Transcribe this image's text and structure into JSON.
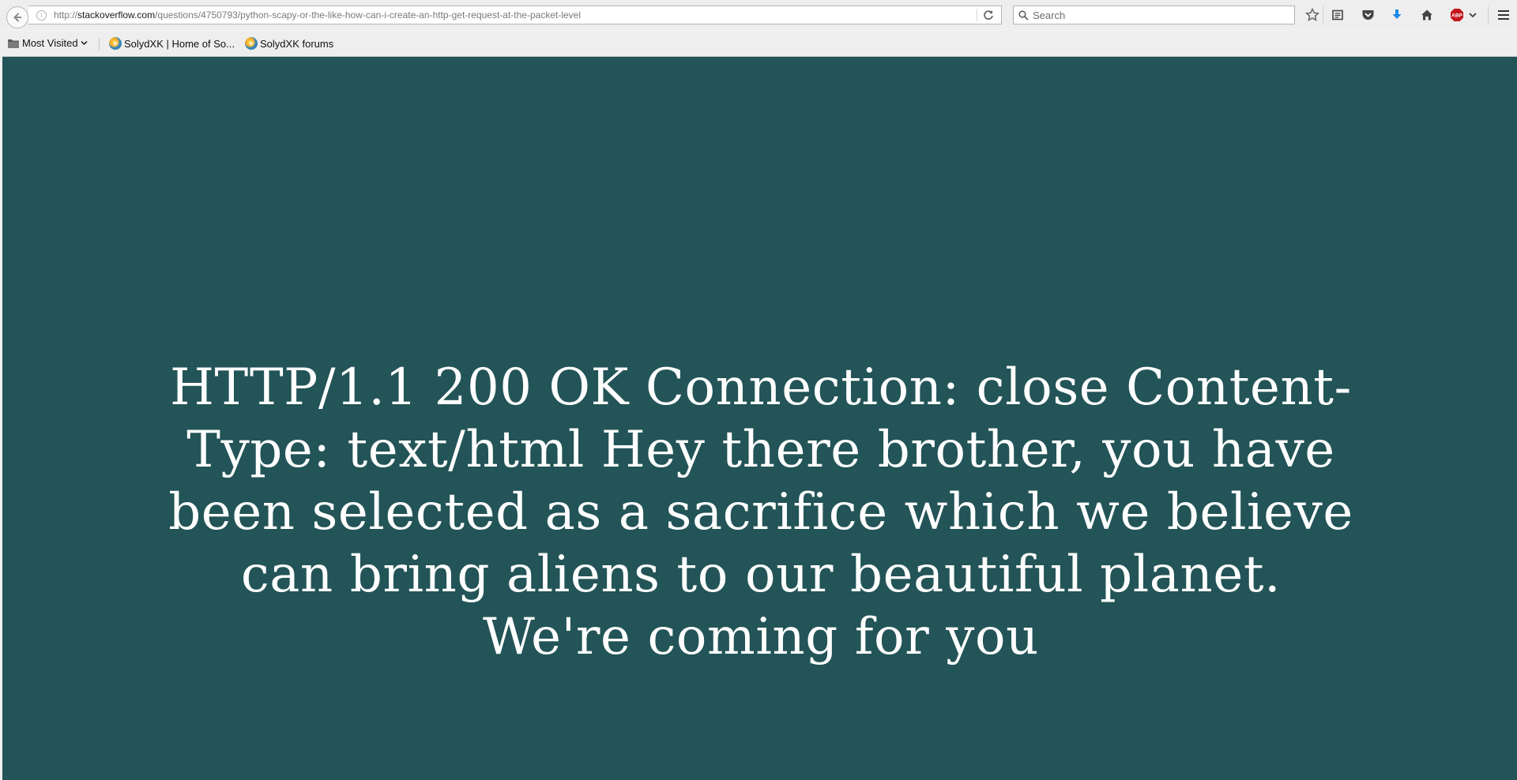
{
  "toolbar": {
    "url_prefix": "http://",
    "url_host": "stackoverflow.com",
    "url_path": "/questions/4750793/python-scapy-or-the-like-how-can-i-create-an-http-get-request-at-the-packet-level",
    "search_placeholder": "Search",
    "icons": [
      "back-icon",
      "info-icon",
      "reload-icon",
      "search-icon",
      "bookmark-star-icon",
      "reading-list-icon",
      "pocket-icon",
      "downloads-icon",
      "home-icon",
      "adblock-plus-icon",
      "chevron-down-icon",
      "menu-icon"
    ],
    "adblock_label": "ABP"
  },
  "bookmarks": {
    "items": [
      {
        "label": "Most Visited",
        "icon": "folder-icon"
      },
      {
        "label": "SolydXK | Home of So...",
        "icon": "solydxk-icon"
      },
      {
        "label": "SolydXK forums",
        "icon": "solydxk-icon"
      }
    ]
  },
  "page": {
    "background": "#235457",
    "text_color": "#ffffff",
    "message": "HTTP/1.1 200 OK Connection: close Content-Type: text/html Hey there brother, you have been selected as a sacrifice which we believe can bring aliens to our beautiful planet. We're coming for you"
  },
  "colors": {
    "download_arrow": "#1e88e5",
    "adblock_red": "#c4161c"
  }
}
